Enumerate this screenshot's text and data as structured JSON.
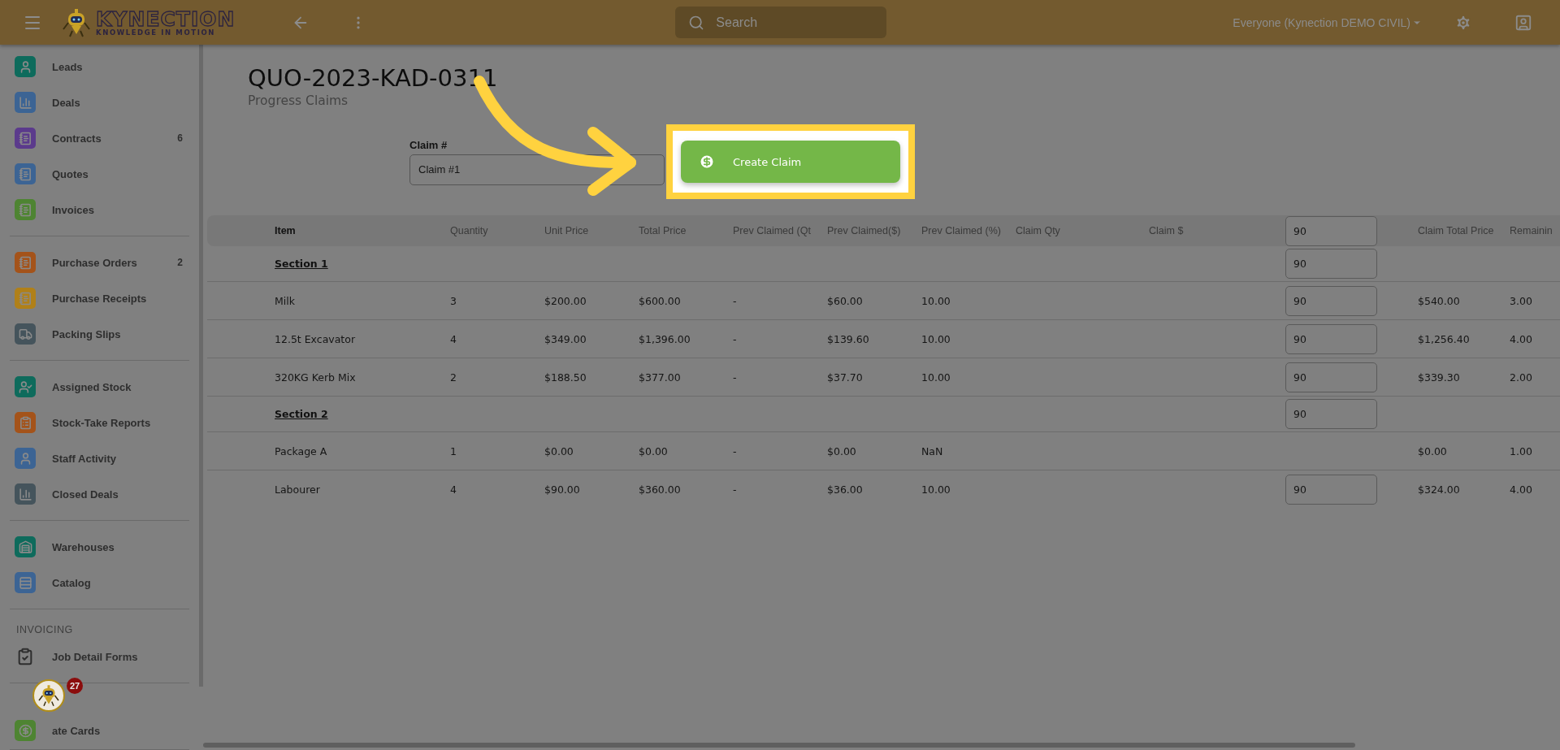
{
  "topbar": {
    "logo": {
      "title": "KYNECTION",
      "tagline": "KNOWLEDGE IN MOTION"
    },
    "search": {
      "placeholder": "Search"
    },
    "account_scope": "Everyone (Kynection DEMO CIVIL)"
  },
  "sidebar": {
    "groups": [
      {
        "items": [
          {
            "label": "Leads",
            "kind": "person",
            "color": "#0e6b5c"
          },
          {
            "label": "Deals",
            "kind": "bars",
            "color": "#3c6494"
          },
          {
            "label": "Contracts",
            "kind": "notebook",
            "color": "#5b3a8c",
            "count": "6"
          },
          {
            "label": "Quotes",
            "kind": "notebook",
            "color": "#3c6494"
          },
          {
            "label": "Invoices",
            "kind": "notebook",
            "color": "#4e8432"
          }
        ]
      },
      {
        "items": [
          {
            "label": "Purchase Orders",
            "kind": "notebook",
            "color": "#a4531a",
            "count": "2"
          },
          {
            "label": "Purchase Receipts",
            "kind": "notebook",
            "color": "#b08019"
          },
          {
            "label": "Packing Slips",
            "kind": "truck",
            "color": "#45545c"
          }
        ]
      },
      {
        "items": [
          {
            "label": "Assigned Stock",
            "kind": "person-check",
            "color": "#0e6b5c"
          },
          {
            "label": "Stock-Take Reports",
            "kind": "checklist",
            "color": "#a4531a"
          },
          {
            "label": "Staff Activity",
            "kind": "person",
            "color": "#3c6494"
          },
          {
            "label": "Closed Deals",
            "kind": "bars",
            "color": "#45545c"
          }
        ]
      },
      {
        "items": [
          {
            "label": "Warehouses",
            "kind": "warehouse",
            "color": "#0e6b5c"
          },
          {
            "label": "Catalog",
            "kind": "catalog",
            "color": "#3c6494"
          }
        ]
      },
      {
        "heading": "INVOICING",
        "items": [
          {
            "label": "Job Detail Forms",
            "kind": "clipboard"
          }
        ]
      },
      {
        "items": [
          {
            "label": "ate Cards",
            "kind": "dollar",
            "color": "#4e8432"
          }
        ]
      }
    ]
  },
  "assistant": {
    "badge": "27"
  },
  "page": {
    "title": "QUO-2023-KAD-0311",
    "subtitle": "Progress Claims",
    "claim_field": {
      "label": "Claim #",
      "value": "Claim #1"
    },
    "create_button": {
      "label": "Create Claim",
      "highlighted": true
    }
  },
  "table": {
    "columns": [
      "Item",
      "Quantity",
      "Unit Price",
      "Total Price",
      "Prev Claimed (Qt",
      "Prev Claimed($)",
      "Prev Claimed (%)",
      "Claim Qty",
      "Claim $",
      "Claim Total Price",
      "Remainin"
    ],
    "header_input": "90",
    "rows": [
      {
        "kind": "section",
        "label": "Section 1",
        "claim_input": "90"
      },
      {
        "kind": "item",
        "cells": [
          "Milk",
          "3",
          "$200.00",
          "$600.00",
          "-",
          "$60.00",
          "10.00",
          "",
          ""
        ],
        "claim_input": "90",
        "claim_total": "$540.00",
        "remaining": "3.00"
      },
      {
        "kind": "item",
        "cells": [
          "12.5t Excavator",
          "4",
          "$349.00",
          "$1,396.00",
          "-",
          "$139.60",
          "10.00",
          "",
          ""
        ],
        "claim_input": "90",
        "claim_total": "$1,256.40",
        "remaining": "4.00"
      },
      {
        "kind": "item",
        "cells": [
          "320KG Kerb Mix",
          "2",
          "$188.50",
          "$377.00",
          "-",
          "$37.70",
          "10.00",
          "",
          ""
        ],
        "claim_input": "90",
        "claim_total": "$339.30",
        "remaining": "2.00"
      },
      {
        "kind": "section",
        "label": "Section 2",
        "claim_input": "90"
      },
      {
        "kind": "item",
        "cells": [
          "Package A",
          "1",
          "$0.00",
          "$0.00",
          "-",
          "$0.00",
          "NaN",
          "",
          ""
        ],
        "claim_total": "$0.00",
        "remaining": "1.00"
      },
      {
        "kind": "item",
        "cells": [
          "Labourer",
          "4",
          "$90.00",
          "$360.00",
          "-",
          "$36.00",
          "10.00",
          "",
          ""
        ],
        "claim_input": "90",
        "claim_total": "$324.00",
        "remaining": "4.00"
      }
    ]
  }
}
